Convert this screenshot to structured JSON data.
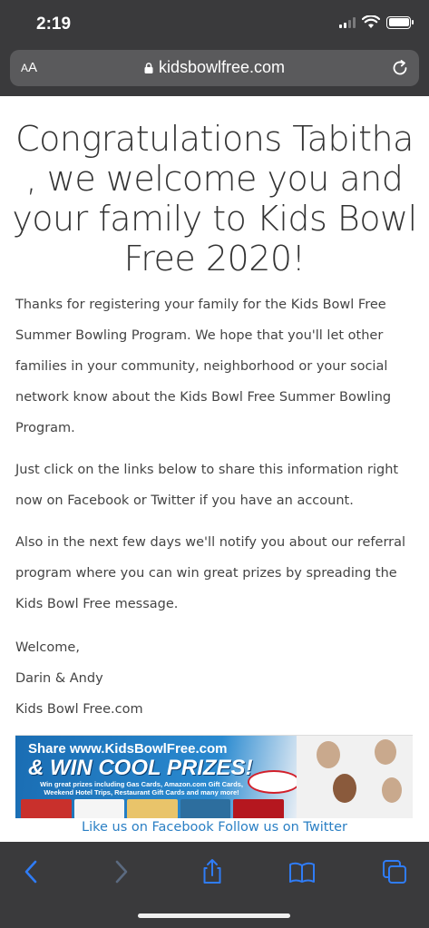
{
  "status": {
    "time": "2:19"
  },
  "browser": {
    "text_size_label": "AA",
    "url": "kidsbowlfree.com"
  },
  "page": {
    "headline": "Congratulations Tabitha , we welcome you and your family to Kids Bowl Free 2020!",
    "paragraphs": [
      "Thanks for registering your family for the Kids Bowl Free Summer Bowling Program. We hope that you'll let other families in your community, neighborhood or your social network know about the Kids Bowl Free Summer Bowling Program.",
      "Just click on the links below to share this information right now on Facebook or Twitter if you have an account.",
      "Also in the next few days we'll notify you about our referral program where you can win great prizes by spreading the Kids Bowl Free message."
    ],
    "signature": [
      "Welcome,",
      "Darin & Andy",
      "Kids Bowl Free.com"
    ],
    "banner": {
      "line1": "Share www.KidsBowlFree.com",
      "line2": "& WIN COOL PRIZES!",
      "line3": "Win great prizes including Gas Cards, Amazon.com Gift Cards, Weekend Hotel Trips, Restaurant Gift Cards and many more!"
    },
    "links": {
      "facebook": "Like us on Facebook",
      "twitter": "Follow us on Twitter"
    }
  },
  "colors": {
    "chrome_bg": "#3a3a3c",
    "link": "#2a7fc4",
    "toolbar_icon_active": "#2f7cf6",
    "toolbar_icon_disabled": "#5b6a80"
  },
  "toolbar_icons": [
    "back-icon",
    "forward-icon",
    "share-icon",
    "bookmarks-icon",
    "tabs-icon"
  ]
}
